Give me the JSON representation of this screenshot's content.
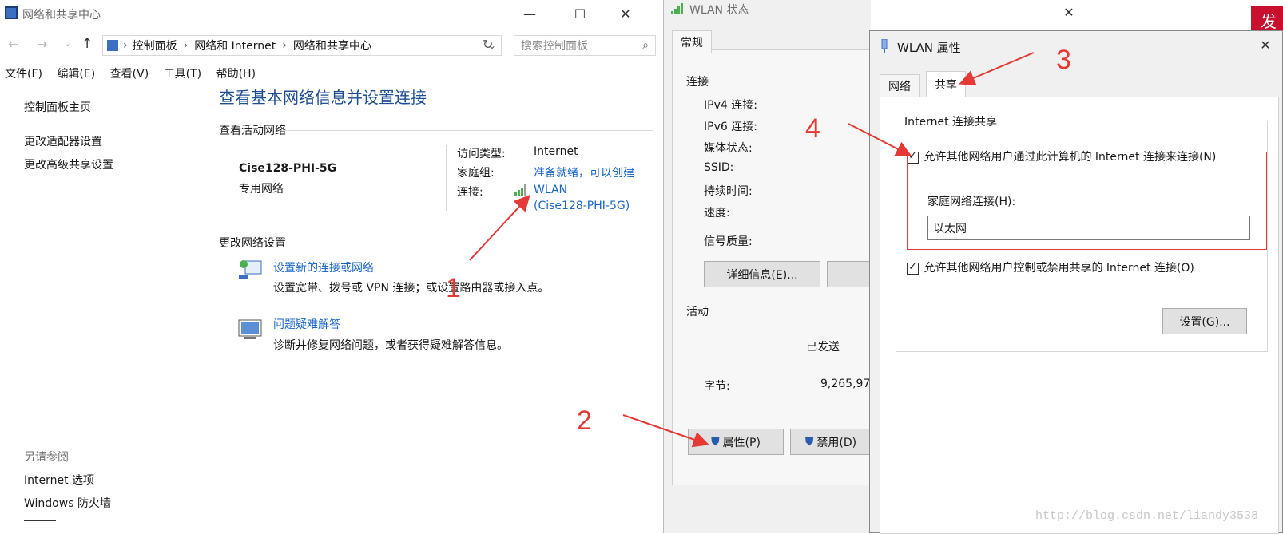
{
  "network_center": {
    "title": "网络和共享中心",
    "breadcrumb": [
      "控制面板",
      "网络和 Internet",
      "网络和共享中心"
    ],
    "search_placeholder": "搜索控制面板",
    "menu": [
      "文件(F)",
      "编辑(E)",
      "查看(V)",
      "工具(T)",
      "帮助(H)"
    ],
    "sidebar": {
      "home": "控制面板主页",
      "items": [
        "更改适配器设置",
        "更改高级共享设置"
      ],
      "see_also_title": "另请参阅",
      "see_also": [
        "Internet 选项",
        "Windows 防火墙"
      ]
    },
    "heading": "查看基本网络信息并设置连接",
    "active_section": "查看活动网络",
    "network_name": "Cise128-PHI-5G",
    "network_type": "专用网络",
    "access_type_label": "访问类型:",
    "access_type_value": "Internet",
    "homegroup_label": "家庭组:",
    "homegroup_value": "准备就绪，可以创建",
    "connection_label": "连接:",
    "connection_line1": "WLAN",
    "connection_line2": "(Cise128-PHI-5G)",
    "change_section": "更改网络设置",
    "tasks": [
      {
        "title": "设置新的连接或网络",
        "desc": "设置宽带、拨号或 VPN 连接；或设置路由器或接入点。"
      },
      {
        "title": "问题疑难解答",
        "desc": "诊断并修复网络问题，或者获得疑难解答信息。"
      }
    ]
  },
  "wlan_status": {
    "title": "WLAN 状态",
    "tab": "常规",
    "connection_group": "连接",
    "rows": [
      "IPv4 连接:",
      "IPv6 连接:",
      "媒体状态:",
      "SSID:",
      "持续时间:",
      "速度:"
    ],
    "signal_quality": "信号质量:",
    "details_button": "详细信息(E)...",
    "activity_group": "活动",
    "sent_label": "已发送",
    "bytes_label": "字节:",
    "bytes_value": "9,265,97",
    "properties_button": "属性(P)",
    "disable_button": "禁用(D)"
  },
  "wlan_properties": {
    "title": "WLAN 属性",
    "tabs": [
      "网络",
      "共享"
    ],
    "group_title": "Internet 连接共享",
    "allow_connect": "允许其他网络用户通过此计算机的 Internet 连接来连接(N)",
    "home_network_label": "家庭网络连接(H):",
    "home_network_value": "以太网",
    "allow_control": "允许其他网络用户控制或禁用共享的 Internet 连接(O)",
    "settings_button": "设置(G)..."
  },
  "annotations": [
    "1",
    "2",
    "3",
    "4"
  ],
  "watermark": "http://blog.csdn.net/liandy3538",
  "edge_text": "发",
  "colors": {
    "annotation": "#e53935",
    "link": "#1a66c8",
    "accent_red": "#c8102e"
  }
}
